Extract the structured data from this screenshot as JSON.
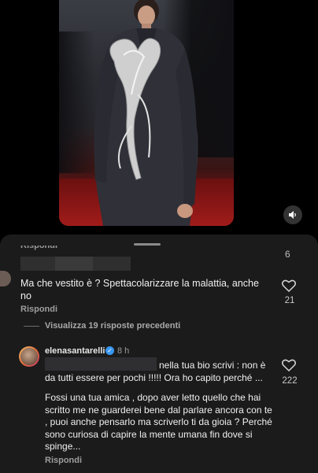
{
  "video": {
    "volume_icon": "speaker-icon"
  },
  "comments": {
    "previous": {
      "reply_label_partial": "Rispondi",
      "like_count": "6"
    },
    "first": {
      "text": "Ma che vestito è ? Spettacolarizzare la malattia, anche no",
      "reply_label": "Rispondi",
      "like_count": "21"
    },
    "view_replies": "Visualizza 19 risposte precedenti",
    "reply": {
      "username": "elenasantarelli",
      "time": "8 h",
      "text_first": "nella tua bio scrivi : non è da tutti essere per pochi !!!!! Ora ho capito perché ...",
      "text_second": "Fossi una tua amica , dopo aver letto quello che hai scritto me ne guarderei bene dal parlare ancora con te , puoi anche pensarlo ma scriverlo ti da gioia ? Perché sono curiosa di capire la mente umana fin dove si spinge...",
      "reply_label": "Rispondi",
      "like_count": "222"
    }
  },
  "colors": {
    "sheet_bg": "#1b1b1b",
    "verified_blue": "#3897f0",
    "carpet_red": "#a01c1a"
  }
}
